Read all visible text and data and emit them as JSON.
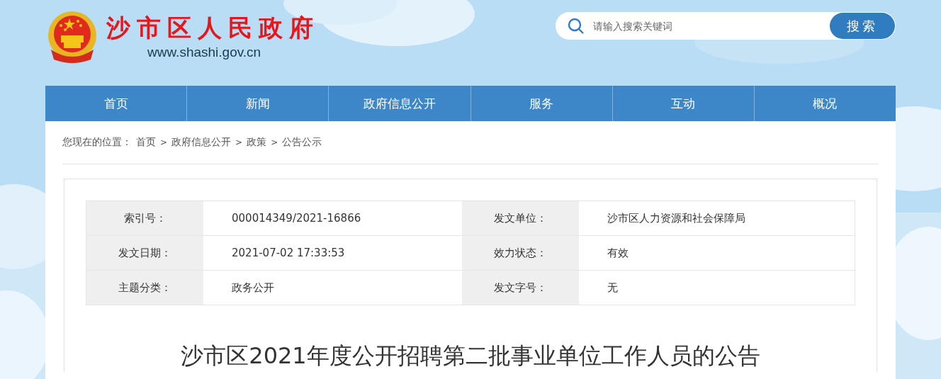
{
  "site": {
    "title": "沙市区人民政府",
    "url": "www.shashi.gov.cn"
  },
  "search": {
    "placeholder": "请输入搜索关键词",
    "button": "搜索"
  },
  "nav": [
    {
      "label": "首页"
    },
    {
      "label": "新闻"
    },
    {
      "label": "政府信息公开"
    },
    {
      "label": "服务"
    },
    {
      "label": "互动"
    },
    {
      "label": "概况"
    }
  ],
  "breadcrumb": {
    "prefix": "您现在的位置：",
    "separator": ">",
    "items": [
      "首页",
      "政府信息公开",
      "政策",
      "公告公示"
    ]
  },
  "meta": [
    {
      "label": "索引号：",
      "value": "000014349/2021-16866"
    },
    {
      "label": "发文单位：",
      "value": "沙市区人力资源和社会保障局"
    },
    {
      "label": "发文日期：",
      "value": "2021-07-02 17:33:53"
    },
    {
      "label": "效力状态：",
      "value": "有效"
    },
    {
      "label": "主题分类：",
      "value": "政务公开"
    },
    {
      "label": "发文字号：",
      "value": "无"
    }
  ],
  "article": {
    "title": "沙市区2021年度公开招聘第二批事业单位工作人员的公告"
  }
}
